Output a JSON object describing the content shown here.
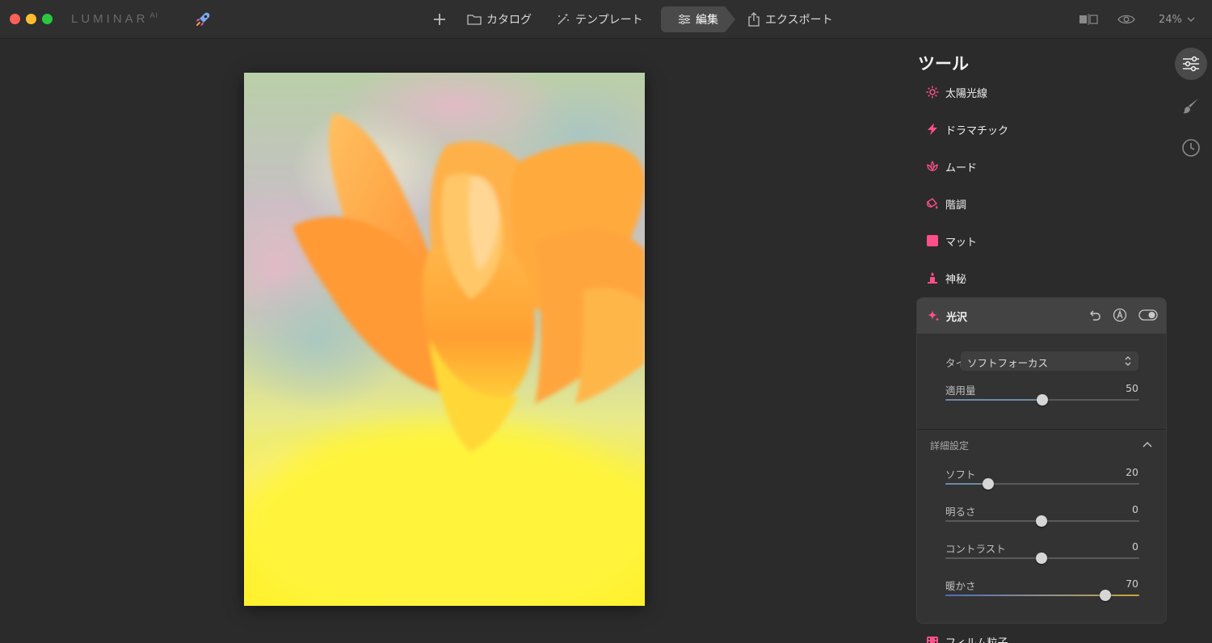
{
  "app": {
    "logo": "LUMINAR",
    "logo_sup": "AI"
  },
  "nav": {
    "catalog": "カタログ",
    "templates": "テンプレート",
    "edit": "編集",
    "export": "エクスポート"
  },
  "toolbar": {
    "zoom": "24%"
  },
  "panel": {
    "title": "ツール",
    "tools": [
      {
        "label": "太陽光線",
        "icon": "sun-icon"
      },
      {
        "label": "ドラマチック",
        "icon": "lightning-icon"
      },
      {
        "label": "ムード",
        "icon": "lotus-icon"
      },
      {
        "label": "階調",
        "icon": "bucket-icon"
      },
      {
        "label": "マット",
        "icon": "square-icon"
      },
      {
        "label": "神秘",
        "icon": "candle-icon"
      }
    ],
    "active_tool": {
      "label": "光沢",
      "icon": "sparkle-icon",
      "type_label": "タイプ:",
      "type_value": "ソフトフォーカス",
      "amount_label": "適用量",
      "amount_value": "50",
      "advanced_label": "詳細設定",
      "sliders": [
        {
          "label": "ソフト",
          "value": "20"
        },
        {
          "label": "明るさ",
          "value": "0"
        },
        {
          "label": "コントラスト",
          "value": "0"
        },
        {
          "label": "暖かさ",
          "value": "70"
        }
      ]
    },
    "next_tool": {
      "label": "フィルム粒子",
      "icon": "film-icon"
    }
  },
  "colors": {
    "accent_pink": "#ff4f8b",
    "panel_bg": "#333333",
    "active_header": "#434343"
  }
}
